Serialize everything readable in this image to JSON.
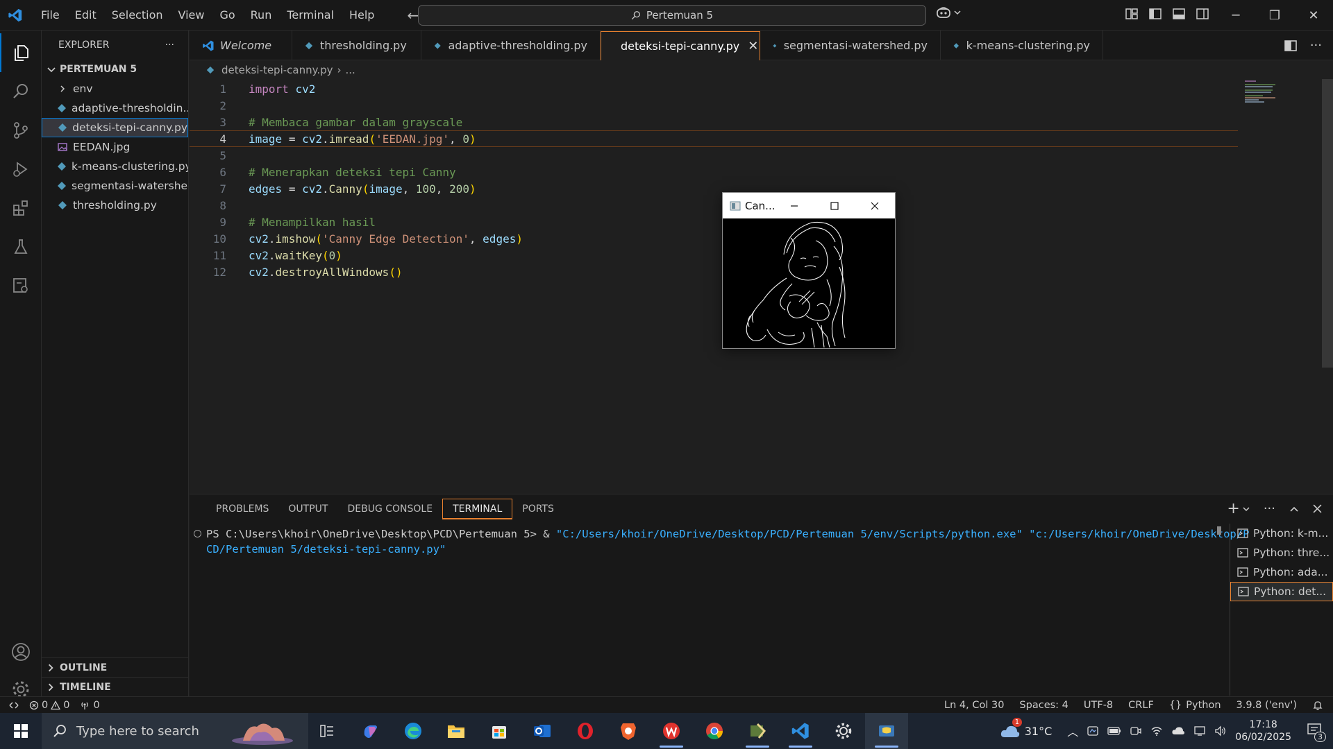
{
  "menu": [
    "File",
    "Edit",
    "Selection",
    "View",
    "Go",
    "Run",
    "Terminal",
    "Help"
  ],
  "command_center": "Pertemuan 5",
  "explorer": {
    "header": "EXPLORER",
    "folder": "PERTEMUAN 5",
    "items": [
      {
        "label": "env",
        "type": "folder"
      },
      {
        "label": "adaptive-thresholdin...",
        "type": "py"
      },
      {
        "label": "deteksi-tepi-canny.py",
        "type": "py"
      },
      {
        "label": "EEDAN.jpg",
        "type": "img"
      },
      {
        "label": "k-means-clustering.py",
        "type": "py"
      },
      {
        "label": "segmentasi-watershe...",
        "type": "py"
      },
      {
        "label": "thresholding.py",
        "type": "py"
      }
    ],
    "outline": "OUTLINE",
    "timeline": "TIMELINE"
  },
  "tabs": [
    {
      "label": "Welcome",
      "italic": true
    },
    {
      "label": "thresholding.py"
    },
    {
      "label": "adaptive-thresholding.py"
    },
    {
      "label": "deteksi-tepi-canny.py",
      "active": true
    },
    {
      "label": "segmentasi-watershed.py"
    },
    {
      "label": "k-means-clustering.py"
    }
  ],
  "breadcrumb": {
    "file": "deteksi-tepi-canny.py",
    "rest": "..."
  },
  "editor": {
    "line_numbers": [
      "1",
      "2",
      "3",
      "4",
      "5",
      "6",
      "7",
      "8",
      "9",
      "10",
      "11",
      "12"
    ],
    "current_line": 4
  },
  "canny_window": {
    "title": "Can..."
  },
  "panel": {
    "tabs": [
      "PROBLEMS",
      "OUTPUT",
      "DEBUG CONSOLE",
      "TERMINAL",
      "PORTS"
    ],
    "active_tab": "TERMINAL",
    "prompt": "PS C:\\Users\\khoir\\OneDrive\\Desktop\\PCD\\Pertemuan 5> & ",
    "cmd_part1": "\"C:/Users/khoir/OneDrive/Desktop/PCD/Pertemuan 5/env/Scripts/python.exe\" \"c:/Users/khoir/OneDrive/Desktop/P",
    "cmd_part2": "CD/Pertemuan 5/deteksi-tepi-canny.py\"",
    "terminals": [
      "Python: k-m...",
      "Python: thre...",
      "Python: ada...",
      "Python: det..."
    ]
  },
  "status": {
    "errors": "0",
    "warnings": "0",
    "ports": "0",
    "position": "Ln 4, Col 30",
    "spaces": "Spaces: 4",
    "encoding": "UTF-8",
    "eol": "CRLF",
    "language": "Python",
    "interpreter": "3.9.8 ('env')"
  },
  "taskbar": {
    "search_placeholder": "Type here to search",
    "weather": "31°C",
    "weather_badge": "1",
    "time": "17:18",
    "date": "06/02/2025",
    "notif_count": "3"
  },
  "colors": {
    "accent": "#0078d4",
    "focus_border": "#e8812f",
    "path_blue": "#3ab0ff"
  }
}
